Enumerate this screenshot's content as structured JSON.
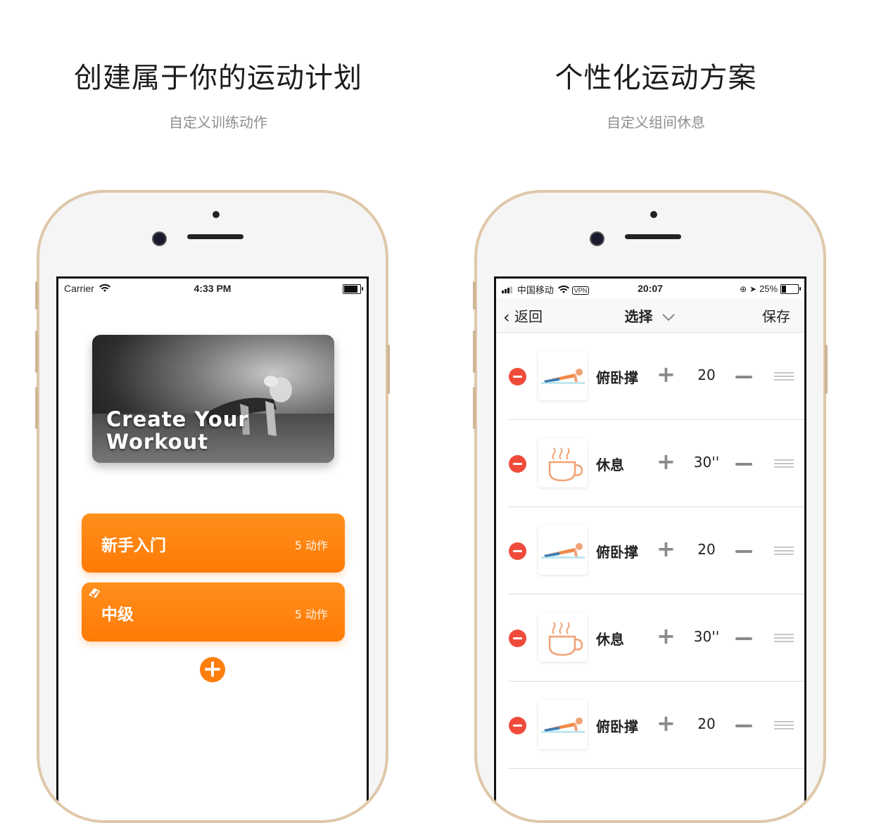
{
  "left_panel": {
    "headline": "创建属于你的运动计划",
    "subline": "自定义训练动作",
    "status": {
      "carrier": "Carrier",
      "time": "4:33 PM"
    },
    "hero_text": "Create Your Workout",
    "plans": [
      {
        "name": "新手入门",
        "count": "5 动作"
      },
      {
        "name": "中级",
        "count": "5 动作"
      }
    ],
    "add_icon": "plus-icon",
    "colors": {
      "accent": "#ff7e0c"
    }
  },
  "right_panel": {
    "headline": "个性化运动方案",
    "subline": "自定义组间休息",
    "status": {
      "carrier": "中国移动",
      "vpn": "VPN",
      "time": "20:07",
      "battery": "25%"
    },
    "nav": {
      "back": "返回",
      "title": "选择",
      "save": "保存"
    },
    "rows": [
      {
        "name": "俯卧撑",
        "value": "20",
        "icon": "pushup-icon"
      },
      {
        "name": "休息",
        "value": "30''",
        "icon": "coffee-cup-icon"
      },
      {
        "name": "俯卧撑",
        "value": "20",
        "icon": "pushup-icon"
      },
      {
        "name": "休息",
        "value": "30''",
        "icon": "coffee-cup-icon"
      },
      {
        "name": "俯卧撑",
        "value": "20",
        "icon": "pushup-icon"
      }
    ],
    "colors": {
      "delete": "#f04b3a",
      "cup": "#f0a274"
    }
  }
}
